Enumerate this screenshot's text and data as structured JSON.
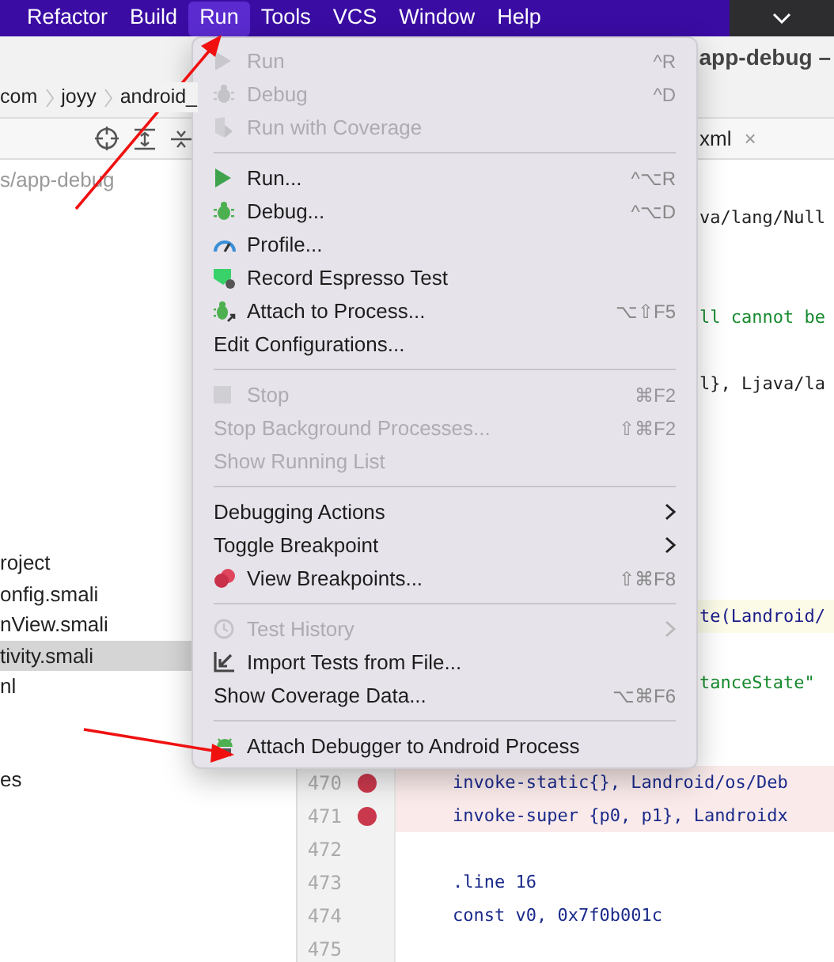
{
  "menubar": {
    "items": [
      {
        "label": "Refactor",
        "selected": false
      },
      {
        "label": "Build",
        "selected": false
      },
      {
        "label": "Run",
        "selected": true
      },
      {
        "label": "Tools",
        "selected": false
      },
      {
        "label": "VCS",
        "selected": false
      },
      {
        "label": "Window",
        "selected": false
      },
      {
        "label": "Help",
        "selected": false
      }
    ]
  },
  "title": "app-debug –",
  "breadcrumb": [
    "com",
    "joyy",
    "android_"
  ],
  "editor_tab": {
    "label": "xml",
    "close": "×"
  },
  "project_tree": {
    "path": "s/app-debug",
    "items": [
      {
        "label": "roject",
        "selected": false
      },
      {
        "label": "onfig.smali",
        "selected": false
      },
      {
        "label": "nView.smali",
        "selected": false
      },
      {
        "label": "tivity.smali",
        "selected": true
      },
      {
        "label": "nl",
        "selected": false
      },
      {
        "label": "es",
        "selected": false
      }
    ]
  },
  "editor": {
    "lines": [
      {
        "kind": "partial",
        "text": "va/lang/Null",
        "highlight": false
      },
      {
        "kind": "partial",
        "text": "ll cannot be",
        "highlight": false
      },
      {
        "kind": "partial",
        "text": "l}, Ljava/la",
        "highlight": false
      },
      {
        "kind": "partial",
        "text": "te(Landroid/",
        "highlight": true
      },
      {
        "kind": "partial",
        "text": "tanceState\"",
        "highlight": false
      },
      {
        "kind": "full",
        "number": "470",
        "text": "invoke-static{}, Landroid/os/Deb",
        "breakpoint": true
      },
      {
        "kind": "full",
        "number": "471",
        "text": "invoke-super {p0, p1}, Landroidx",
        "breakpoint": true
      },
      {
        "kind": "full",
        "number": "472",
        "breakpoint": false
      },
      {
        "kind": "full",
        "number": "473",
        "text": ".line 16",
        "breakpoint": false
      },
      {
        "kind": "full",
        "number": "474",
        "text": "const v0, 0x7f0b001c",
        "breakpoint": false
      },
      {
        "kind": "full",
        "number": "475",
        "breakpoint": false
      }
    ]
  },
  "run_menu": {
    "items": [
      {
        "kind": "item",
        "label": "Run",
        "shortcut": "^R",
        "disabled": true
      },
      {
        "kind": "item",
        "label": "Debug",
        "shortcut": "^D",
        "disabled": true
      },
      {
        "kind": "item",
        "label": "Run with Coverage",
        "disabled": true
      },
      {
        "kind": "separator"
      },
      {
        "kind": "item",
        "label": "Run...",
        "shortcut": "^⌥R",
        "disabled": false
      },
      {
        "kind": "item",
        "label": "Debug...",
        "shortcut": "^⌥D",
        "disabled": false
      },
      {
        "kind": "item",
        "label": "Profile...",
        "disabled": false
      },
      {
        "kind": "item",
        "label": "Record Espresso Test",
        "disabled": false
      },
      {
        "kind": "item",
        "label": "Attach to Process...",
        "shortcut": "⌥⇧F5",
        "disabled": false
      },
      {
        "kind": "item",
        "label": "Edit Configurations...",
        "disabled": false
      },
      {
        "kind": "separator"
      },
      {
        "kind": "item",
        "label": "Stop",
        "shortcut": "⌘F2",
        "disabled": true
      },
      {
        "kind": "item",
        "label": "Stop Background Processes...",
        "shortcut": "⇧⌘F2",
        "disabled": true
      },
      {
        "kind": "item",
        "label": "Show Running List",
        "disabled": true
      },
      {
        "kind": "separator"
      },
      {
        "kind": "item",
        "label": "Debugging Actions",
        "submenu": true,
        "disabled": false
      },
      {
        "kind": "item",
        "label": "Toggle Breakpoint",
        "submenu": true,
        "disabled": false
      },
      {
        "kind": "item",
        "label": "View Breakpoints...",
        "shortcut": "⇧⌘F8",
        "disabled": false
      },
      {
        "kind": "separator"
      },
      {
        "kind": "item",
        "label": "Test History",
        "submenu": true,
        "disabled": true
      },
      {
        "kind": "item",
        "label": "Import Tests from File...",
        "disabled": false
      },
      {
        "kind": "item",
        "label": "Show Coverage Data...",
        "shortcut": "⌥⌘F6",
        "disabled": false
      },
      {
        "kind": "separator"
      },
      {
        "kind": "item",
        "label": "Attach Debugger to Android Process",
        "disabled": false
      }
    ]
  }
}
